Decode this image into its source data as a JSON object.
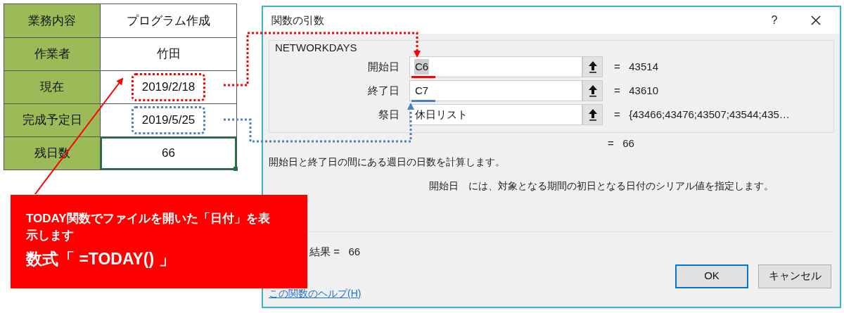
{
  "sheet": {
    "rows": [
      {
        "label": "業務内容",
        "value": "プログラム作成",
        "selected": false
      },
      {
        "label": "作業者",
        "value": "竹田",
        "selected": false
      },
      {
        "label": "現在",
        "value": "2019/2/18",
        "selected": false,
        "color": "#ff0000"
      },
      {
        "label": "完成予定日",
        "value": "2019/5/25",
        "selected": false,
        "color": "#4f81bd"
      },
      {
        "label": "残日数",
        "value": "66",
        "selected": true
      }
    ]
  },
  "dialog": {
    "title": "関数の引数",
    "help_button": "?",
    "function_name": "NETWORKDAYS",
    "arguments": [
      {
        "label": "開始日",
        "value": "C6",
        "result": "=   43514",
        "highlighted": true,
        "color": "#ff0000"
      },
      {
        "label": "終了日",
        "value": "C7",
        "result": "=   43610",
        "highlighted": false,
        "color": "#4f81bd"
      },
      {
        "label": "祭日",
        "value": "休日リスト",
        "result": "=   {43466;43476;43507;43544;435…",
        "highlighted": false
      }
    ],
    "formula_result": "=   66",
    "description": "開始日と終了日の間にある週日の日数を計算します。",
    "argument_help": {
      "name": "開始日",
      "text": "には、対象となる期間の初日となる日付のシリアル値を指定します。"
    },
    "result_line": "結果 =   66",
    "help_link": "この関数のヘルプ(H)",
    "buttons": [
      {
        "label": "OK",
        "selected": true
      },
      {
        "label": "キャンセル",
        "selected": false
      }
    ]
  },
  "callout": {
    "lines": [
      "TODAY関数でファイルを開いた「日付」を表示します",
      "数式「 =TODAY() 」"
    ]
  }
}
